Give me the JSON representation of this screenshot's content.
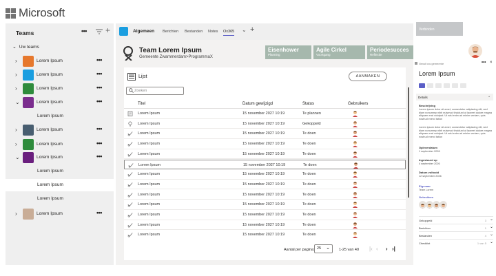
{
  "brand": {
    "wordmark": "Microsoft"
  },
  "teams_panel": {
    "title": "Teams",
    "more": "•••",
    "add": "+",
    "your_teams": "Uw teams",
    "teams": [
      {
        "name": "Lorem Ipsum",
        "color": "#e6782d",
        "chevron": "›",
        "more": "•••",
        "level": "top"
      },
      {
        "name": "Lorem Ipsum",
        "color": "#1a9ee0",
        "chevron": "›",
        "more": "•••",
        "level": "top"
      },
      {
        "name": "Lorem Ipsum",
        "color": "#2e8b3c",
        "chevron": "›",
        "more": "•••",
        "level": "top"
      },
      {
        "name": "Lorem Ipsum",
        "color": "#7b2d8e",
        "chevron": "⌄",
        "more": "•••",
        "level": "top"
      },
      {
        "name": "Lorem Ipsum",
        "level": "sub"
      },
      {
        "name": "Lorem Ipsum",
        "color": "#485e70",
        "chevron": "›",
        "more": "•••",
        "level": "top"
      },
      {
        "name": "Lorem Ipsum",
        "color": "#2e8b3c",
        "chevron": "›",
        "more": "•••",
        "level": "top"
      },
      {
        "name": "Lorem Ipsum",
        "color": "#6a1f7e",
        "chevron": "⌄",
        "more": "•••",
        "level": "top"
      },
      {
        "name": "Lorem Ipsum",
        "level": "sub"
      },
      {
        "name": "Lorem Ipsum",
        "level": "sub",
        "selected": true
      },
      {
        "name": "Lorem Ipsum",
        "level": "sub"
      },
      {
        "name": "Lorem Ipsum",
        "color": "#c9ad97",
        "chevron": "›",
        "more": "•••",
        "level": "top"
      }
    ]
  },
  "channel": {
    "name": "Algemeen",
    "tabs": [
      "Berichten",
      "Bestanden",
      "Notes",
      "Ox365"
    ],
    "active_tab": "Ox365",
    "chevron": "⌄",
    "add": "+"
  },
  "team_header": {
    "title": "Team Lorem Ipsum",
    "path": "Gemeente Zwammerdam>ProgrammaX",
    "tiles": [
      {
        "title": "Eisenhower",
        "subtitle": "Planning"
      },
      {
        "title": "Agile Cirkel",
        "subtitle": "Voortgang"
      },
      {
        "title": "Periodesucces",
        "subtitle": "Reflectie"
      },
      {
        "title": "Verbinden",
        "subtitle": "",
        "disabled": true
      }
    ]
  },
  "list": {
    "title": "Lijst",
    "add_button": "AANMAKEN",
    "search_placeholder": "Zoeken",
    "columns": [
      "Titel",
      "Datum gewijzigd",
      "Status",
      "Gebruikers"
    ],
    "rows": [
      {
        "icon": "clipboard",
        "title": "Lorem Ipsum",
        "date": "15 november 2027 10:19",
        "status": "Te plannen"
      },
      {
        "icon": "bulb",
        "title": "Lorem Ipsum",
        "date": "15 november 2027 10:19",
        "status": "Gekoppeld"
      },
      {
        "icon": "check",
        "title": "Lorem Ipsum",
        "date": "15 november 2027 10:19",
        "status": "Te doen"
      },
      {
        "icon": "check",
        "title": "Lorem Ipsum",
        "date": "15 november 2027 10:19",
        "status": "Te doen"
      },
      {
        "icon": "check",
        "title": "Lorem Ipsum",
        "date": "15 november 2027 10:19",
        "status": "Te doen"
      },
      {
        "icon": "check",
        "title": "Lorem Ipsum",
        "date": "15 november 2027 10:19",
        "status": "Te doen",
        "highlight": true
      },
      {
        "icon": "check",
        "title": "Lorem Ipsum",
        "date": "15 november 2027 10:19",
        "status": "Te doen"
      },
      {
        "icon": "check",
        "title": "Lorem Ipsum",
        "date": "15 november 2027 10:19",
        "status": "Te doen"
      },
      {
        "icon": "check",
        "title": "Lorem Ipsum",
        "date": "15 november 2027 10:19",
        "status": "Te doen"
      },
      {
        "icon": "check",
        "title": "Lorem Ipsum",
        "date": "15 november 2027 10:19",
        "status": "Te doen"
      },
      {
        "icon": "check",
        "title": "Lorem Ipsum",
        "date": "15 november 2027 10:19",
        "status": "Te doen"
      },
      {
        "icon": "check",
        "title": "Lorem Ipsum",
        "date": "15 november 2027 10:19",
        "status": "Te doen"
      },
      {
        "icon": "check",
        "title": "Lorem Ipsum",
        "date": "15 november 2027 10:19",
        "status": "Te doen"
      }
    ],
    "pager": {
      "label": "Aantal per pagina:",
      "per_page": "25",
      "range": "1-25 van 40",
      "first": "|‹",
      "prev": "‹",
      "next": "›",
      "last": "›|"
    }
  },
  "details": {
    "top_label": "Vanuit uw gemeente",
    "more": "•••",
    "close": "×",
    "title": "Lorem Ipsum",
    "section": "Details",
    "section_chevron": "⌃",
    "beschrijving_label": "Beschrijving",
    "beschrijving": "Lorem ipsum dolor sit amet, consectetur adipiscing elit, sed diam nonummy nibh euismod tincidunt ut laoreet dolore magna aliquam erat volutpat. Ut wisi enim ad minim veniam, quis nostrud exerci tation",
    "beschrijving2": "Lorem ipsum dolor sit amet, consectetur adipiscing elit, sed diam nonummy nibh euismod tincidunt ut laoreet dolore magna aliquam erat volutpat. Ut wisi enim ad minim veniam, quis nostrud exerci tation",
    "fields": [
      {
        "label": "Opleverdatum",
        "value": "1 september 2026"
      },
      {
        "label": "Ingestuurd op",
        "value": "4 september 2026"
      },
      {
        "label": "Datum voltooid",
        "value": "12 september 2026"
      }
    ],
    "eigenaar_label": "Eigenaar",
    "eigenaar": "Team Lorem",
    "gebruikers_label": "Gebruikers",
    "accordions": [
      {
        "label": "Gekoppeld",
        "count": "3"
      },
      {
        "label": "Berichten",
        "count": "1"
      },
      {
        "label": "Bestanden",
        "count": "4"
      },
      {
        "label": "Checklist",
        "count": "1 van 5"
      }
    ]
  },
  "colors": {
    "accent": "#5b5fc7",
    "tile": "#a6b8ad",
    "tile_disabled": "#c5c7c9"
  }
}
